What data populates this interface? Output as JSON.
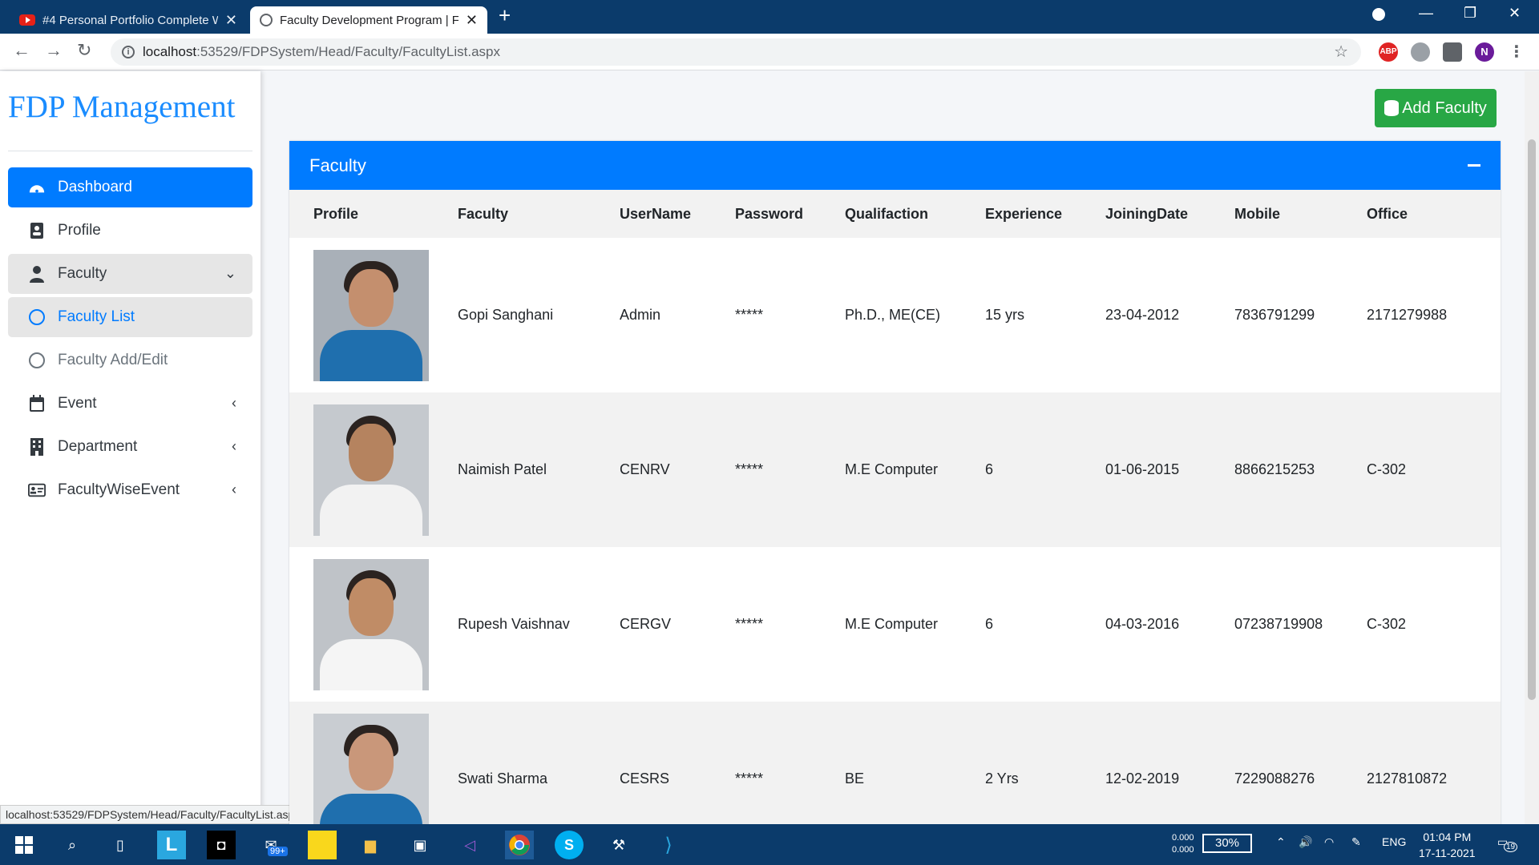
{
  "browser": {
    "tabs": [
      {
        "title": "#4 Personal Portfolio Complete W"
      },
      {
        "title": "Faculty Development Program | F"
      }
    ],
    "url_host": "localhost",
    "url_rest": ":53529/FDPSystem/Head/Faculty/FacultyList.aspx",
    "profile_initial": "N",
    "ext_abp": "ABP"
  },
  "sidebar": {
    "brand": "FDP Management",
    "items": [
      {
        "label": "Dashboard",
        "icon": "dashboard-icon"
      },
      {
        "label": "Profile",
        "icon": "profile-icon"
      },
      {
        "label": "Faculty",
        "icon": "user-icon"
      },
      {
        "label": "Faculty List",
        "icon": "circle-icon"
      },
      {
        "label": "Faculty Add/Edit",
        "icon": "circle-icon"
      },
      {
        "label": "Event",
        "icon": "calendar-icon"
      },
      {
        "label": "Department",
        "icon": "building-icon"
      },
      {
        "label": "FacultyWiseEvent",
        "icon": "id-card-icon"
      }
    ]
  },
  "status_url": "localhost:53529/FDPSystem/Head/Faculty/FacultyList.aspx",
  "main": {
    "add_button": "Add Faculty",
    "card_title": "Faculty",
    "columns": [
      "Profile",
      "Faculty",
      "UserName",
      "Password",
      "Qualifaction",
      "Experience",
      "JoiningDate",
      "Mobile",
      "Office"
    ],
    "rows": [
      {
        "faculty": "Gopi Sanghani",
        "username": "Admin",
        "password": "*****",
        "qualification": "Ph.D., ME(CE)",
        "experience": "15 yrs",
        "joining": "23-04-2012",
        "mobile": "7836791299",
        "office": "2171279988"
      },
      {
        "faculty": "Naimish Patel",
        "username": "CENRV",
        "password": "*****",
        "qualification": "M.E Computer",
        "experience": "6",
        "joining": "01-06-2015",
        "mobile": "8866215253",
        "office": "C-302"
      },
      {
        "faculty": "Rupesh Vaishnav",
        "username": "CERGV",
        "password": "*****",
        "qualification": "M.E Computer",
        "experience": "6",
        "joining": "04-03-2016",
        "mobile": "07238719908",
        "office": "C-302"
      },
      {
        "faculty": "Swati Sharma",
        "username": "CESRS",
        "password": "*****",
        "qualification": "BE",
        "experience": "2 Yrs",
        "joining": "12-02-2019",
        "mobile": "7229088276",
        "office": "2127810872"
      }
    ]
  },
  "taskbar": {
    "mail_badge": "99+",
    "net_up": "0.000",
    "net_down": "0.000",
    "battery": "30%",
    "lang": "ENG",
    "time": "01:04 PM",
    "date": "17-11-2021",
    "notif_count": "19"
  },
  "colors": {
    "accent": "#007bff",
    "success": "#28a745",
    "brand": "#1a8cff"
  }
}
